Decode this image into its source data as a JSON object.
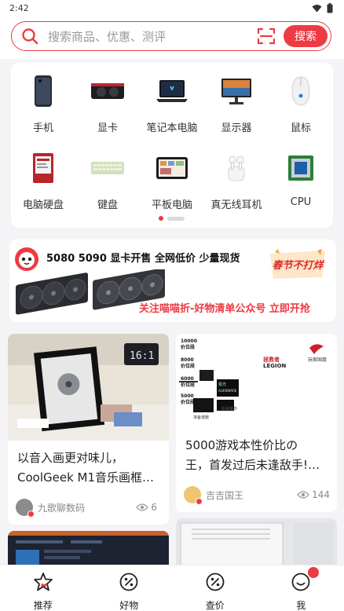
{
  "status_bar": {
    "time": "2:42"
  },
  "search": {
    "placeholder": "搜索商品、优惠、测评",
    "button_label": "搜索"
  },
  "categories": [
    {
      "label": "手机",
      "icon": "phone-icon"
    },
    {
      "label": "显卡",
      "icon": "gpu-icon"
    },
    {
      "label": "笔记本电脑",
      "icon": "laptop-icon"
    },
    {
      "label": "显示器",
      "icon": "monitor-icon"
    },
    {
      "label": "鼠标",
      "icon": "mouse-icon"
    },
    {
      "label": "电脑硬盘",
      "icon": "hard-drive-icon"
    },
    {
      "label": "键盘",
      "icon": "keyboard-icon"
    },
    {
      "label": "平板电脑",
      "icon": "tablet-icon"
    },
    {
      "label": "真无线耳机",
      "icon": "earbuds-icon"
    },
    {
      "label": "CPU",
      "icon": "cpu-icon"
    }
  ],
  "category_pager": {
    "pages": 2,
    "current": 1
  },
  "banner": {
    "title": "5080 5090 显卡开售 全网低价 少量现货",
    "badge": "春节不打烊",
    "subtitle": "关注喵喵折-好物清单公众号 立即开抢"
  },
  "feed": [
    {
      "title_lines": [
        "以音入画更对味儿，",
        "CoolGeek M1音乐画框…"
      ],
      "author": "九歌聊数码",
      "views": "6"
    },
    {
      "title_lines": [
        "5000游戏本性价比の",
        "王，首发过后未逢敌手!…"
      ],
      "author": "吉吉国王",
      "views": "144",
      "image_text": {
        "price_labels": [
          "10000",
          "价位段",
          "8000",
          "价位段",
          "6000",
          "价位段",
          "5000",
          "价位段"
        ],
        "brand_label": "拯救者",
        "brand_sub": "LEGION",
        "rog_label": "玩家国度",
        "tags": [
          "机械革命",
          "极光",
          "ALIENWARE"
        ],
        "footer": "准备爆删"
      }
    }
  ],
  "tabs": [
    {
      "label": "推荐",
      "icon": "star-icon"
    },
    {
      "label": "好物",
      "icon": "discount-icon"
    },
    {
      "label": "查价",
      "icon": "price-check-icon"
    },
    {
      "label": "我",
      "icon": "smiley-icon"
    }
  ],
  "colors": {
    "accent": "#ee3a43",
    "background": "#f4f4f6"
  }
}
